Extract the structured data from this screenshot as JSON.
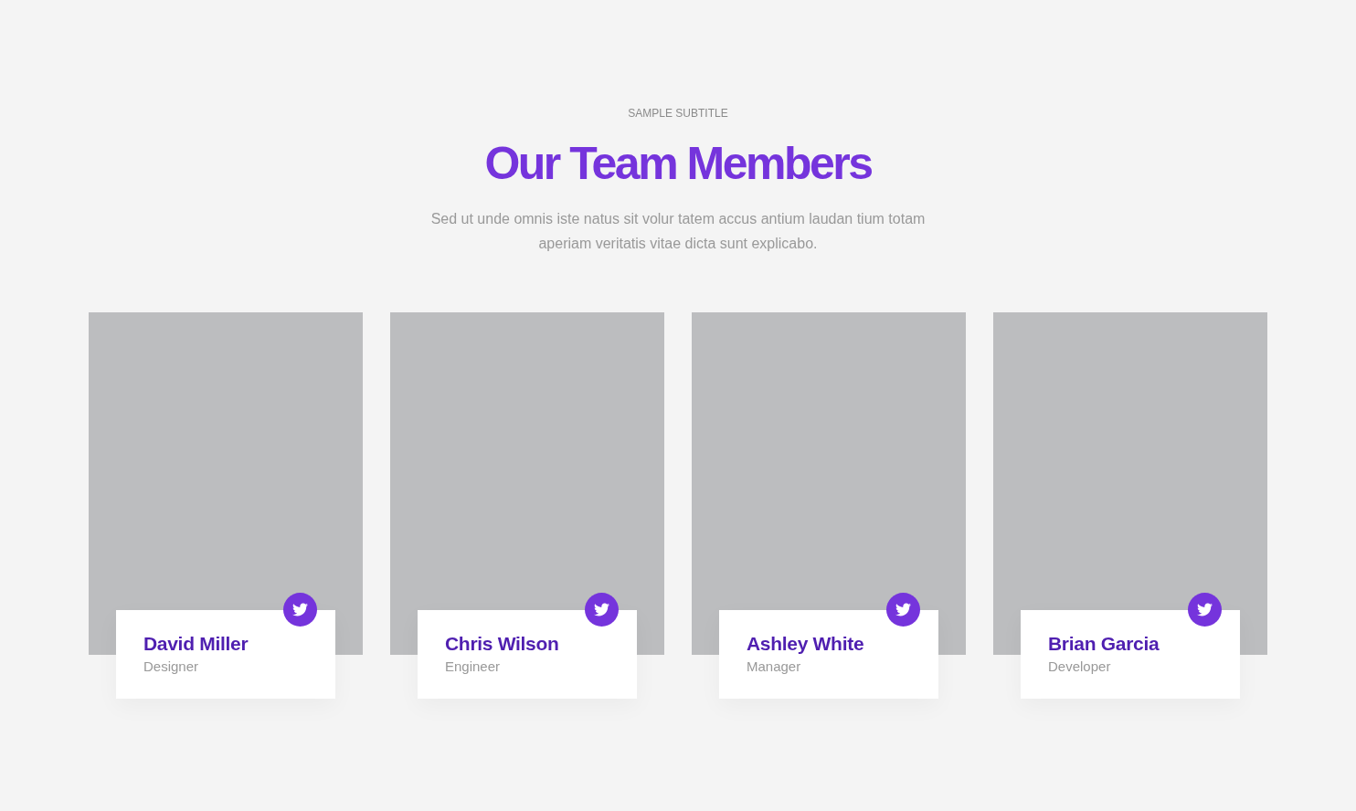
{
  "header": {
    "subtitle": "SAMPLE SUBTITLE",
    "title": "Our Team Members",
    "description": "Sed ut unde omnis iste natus sit volur tatem accus antium laudan tium totam aperiam veritatis vitae dicta sunt explicabo."
  },
  "members": [
    {
      "name": "David Miller",
      "role": "Designer"
    },
    {
      "name": "Chris Wilson",
      "role": "Engineer"
    },
    {
      "name": "Ashley White",
      "role": "Manager"
    },
    {
      "name": "Brian Garcia",
      "role": "Developer"
    }
  ]
}
